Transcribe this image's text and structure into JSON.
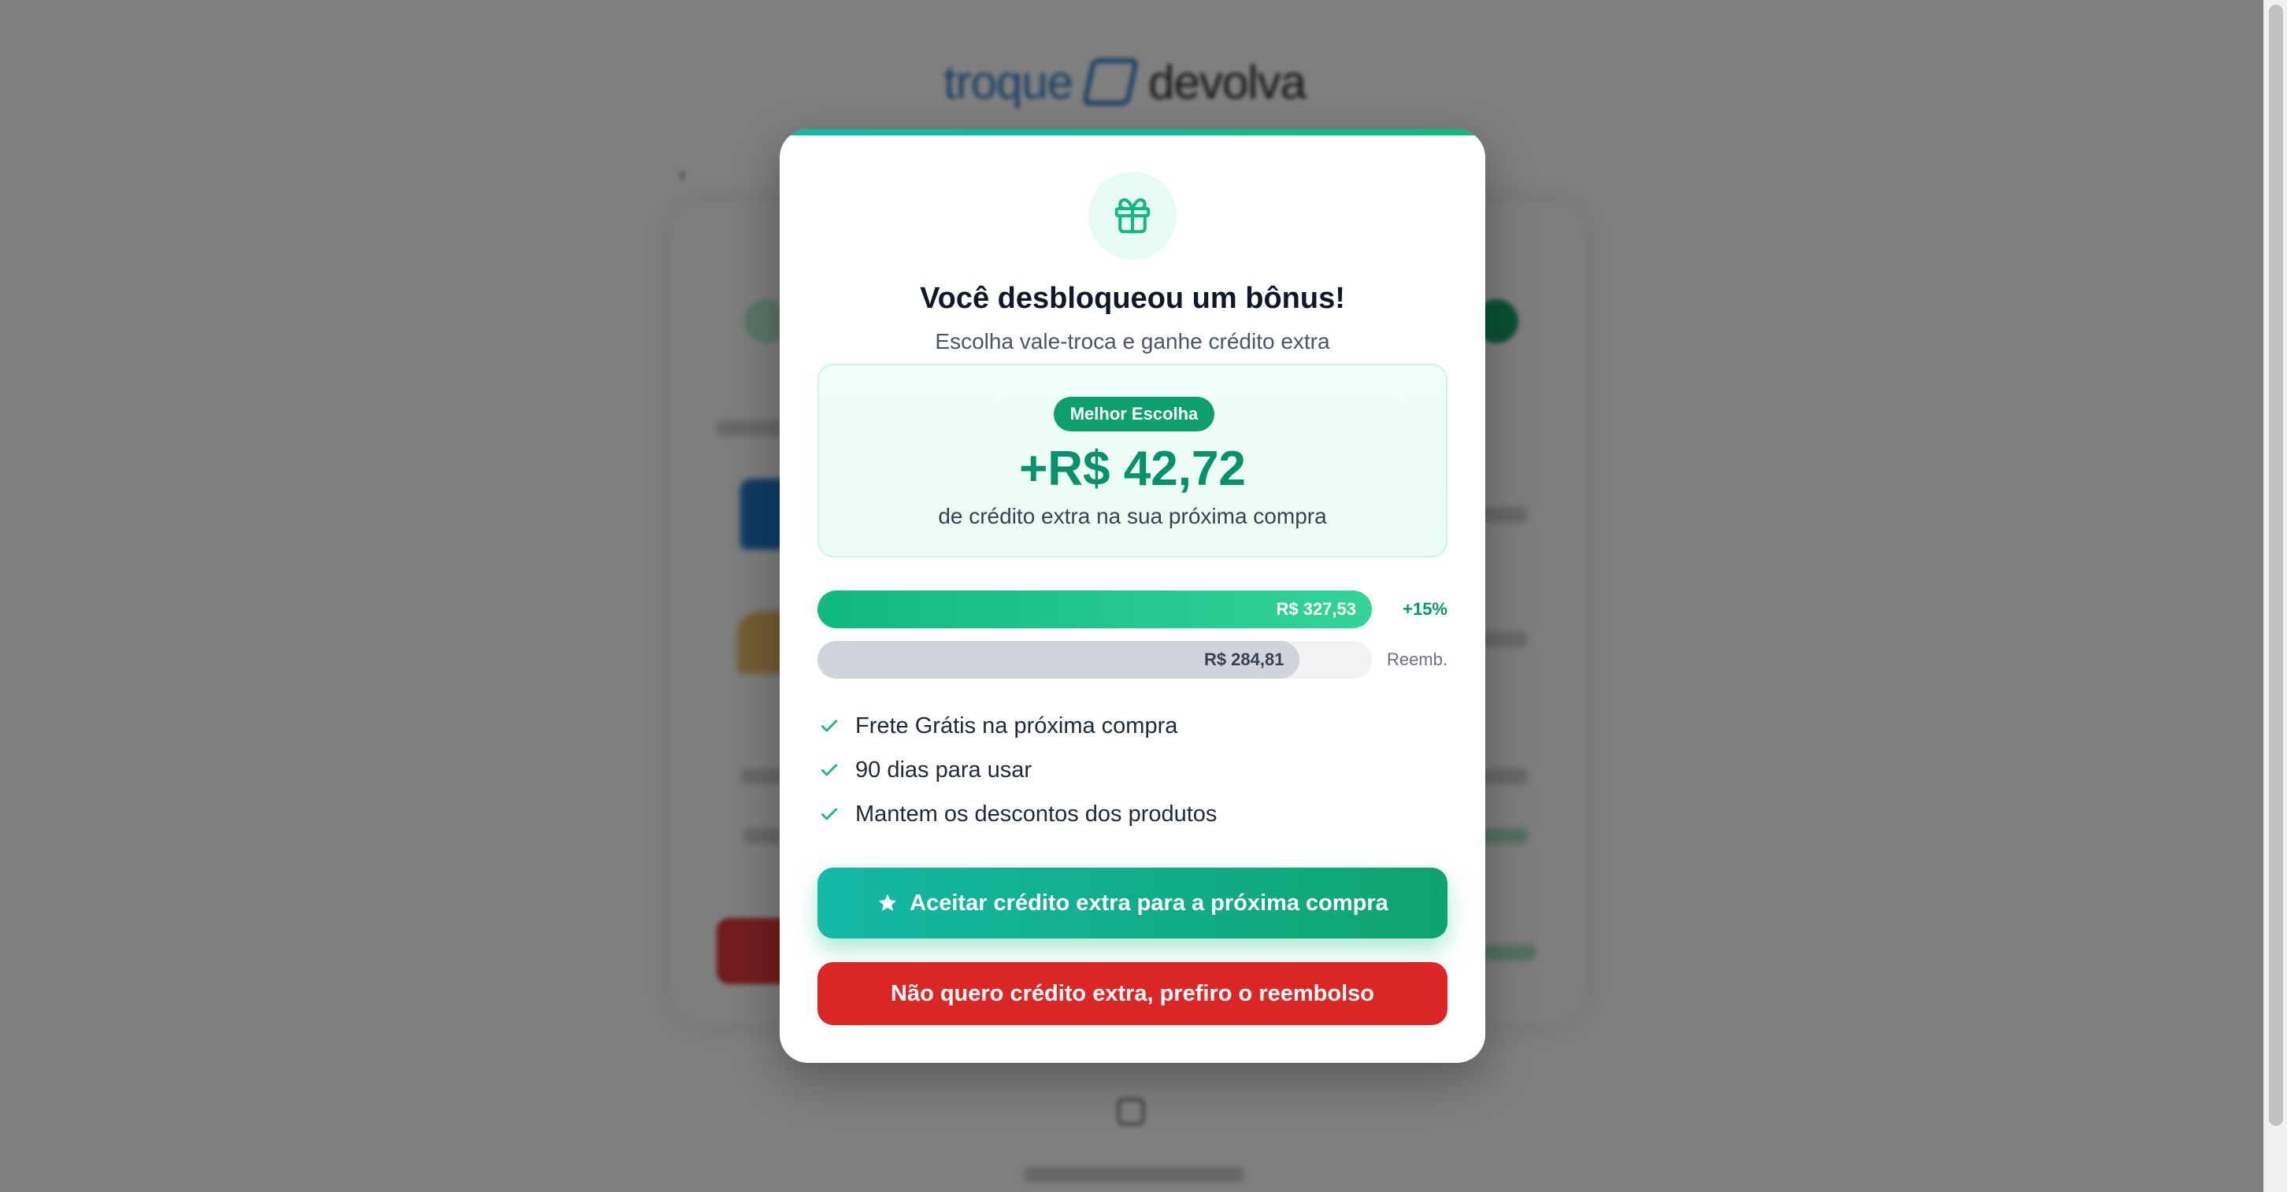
{
  "modal": {
    "title": "Você desbloqueou um bônus!",
    "subtitle": "Escolha vale-troca e ganhe crédito extra",
    "icon": "gift-icon",
    "offer": {
      "badge": "Melhor Escolha",
      "amount": "+R$ 42,72",
      "description": "de crédito extra na sua próxima compra"
    },
    "comparison": {
      "credit": {
        "value_label": "R$ 327,53",
        "side_label": "+15%",
        "fill_fraction": 1.0
      },
      "refund": {
        "value_label": "R$ 284,81",
        "side_label": "Reemb.",
        "fill_fraction": 0.87
      }
    },
    "benefits": [
      "Frete Grátis na próxima compra",
      "90 dias para usar",
      "Mantem os descontos dos produtos"
    ],
    "accept_button": "Aceitar crédito extra para a próxima compra",
    "decline_button": "Não quero crédito extra, prefiro o reembolso"
  },
  "colors": {
    "accent": "#10b981",
    "accent_dark": "#05916b",
    "danger": "#dc2626",
    "overlay": "rgba(0,0,0,0.5)"
  }
}
